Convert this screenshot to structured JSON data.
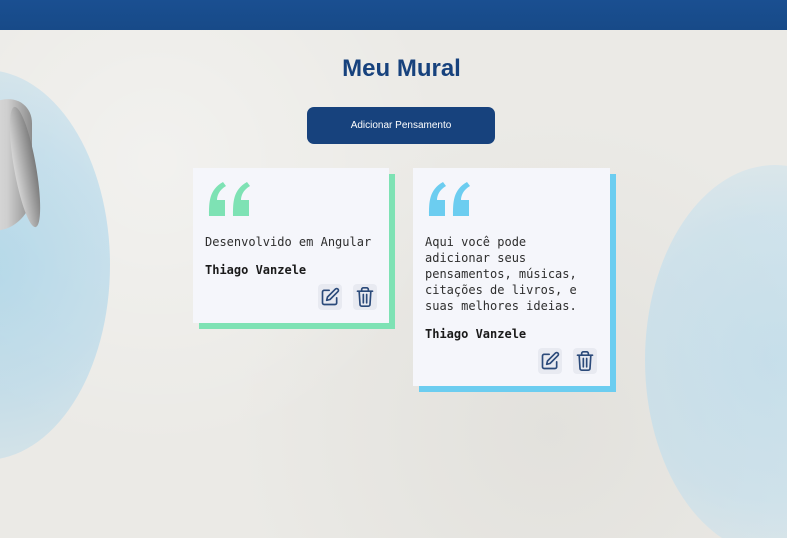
{
  "page": {
    "title": "Meu Mural",
    "add_button_label": "Adicionar Pensamento"
  },
  "cards": [
    {
      "text": "Desenvolvido em Angular",
      "author": "Thiago Vanzele",
      "accent_color": "#7ee2b4",
      "quote_color": "#7ee2b4"
    },
    {
      "text_lines": [
        "Aqui você pode",
        "adicionar seus",
        "pensamentos, músicas,",
        "citações de livros, e",
        "suas melhores ideias."
      ],
      "author": "Thiago Vanzele",
      "accent_color": "#6ccdf0",
      "quote_color": "#6ccdf0"
    }
  ],
  "colors": {
    "topbar": "#174a88",
    "title": "#17427d",
    "button": "#17427d",
    "icon": "#2b4a7a"
  },
  "icons": [
    "edit-icon",
    "trash-icon"
  ]
}
